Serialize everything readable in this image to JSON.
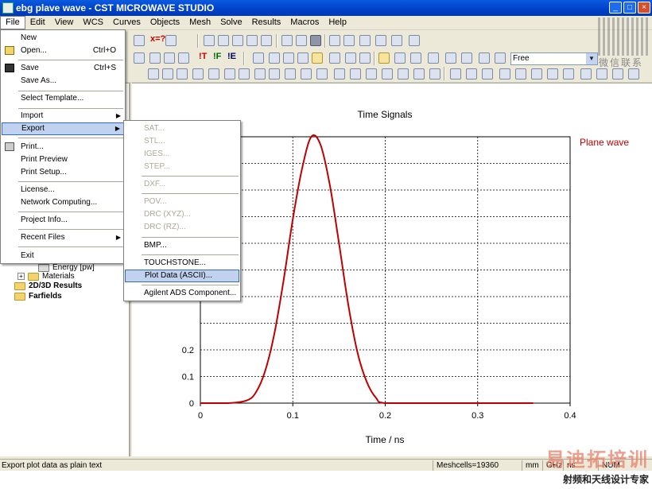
{
  "window": {
    "title": "ebg plave wave - CST MICROWAVE STUDIO",
    "buttons": [
      "_",
      "□",
      "×"
    ]
  },
  "menubar": {
    "items": [
      "File",
      "Edit",
      "View",
      "WCS",
      "Curves",
      "Objects",
      "Mesh",
      "Solve",
      "Results",
      "Macros",
      "Help"
    ],
    "active": "File"
  },
  "toolbar": {
    "free_combo": "Free",
    "text_buttons": [
      "x=?",
      "!T",
      "!F",
      "!E"
    ]
  },
  "file_menu": {
    "items": [
      {
        "label": "New",
        "shortcut": ""
      },
      {
        "label": "Open...",
        "shortcut": "Ctrl+O"
      },
      {
        "label": "Save",
        "shortcut": "Ctrl+S"
      },
      {
        "label": "Save As...",
        "shortcut": ""
      },
      {
        "label": "Select Template...",
        "shortcut": ""
      },
      {
        "label": "Import",
        "shortcut": "",
        "submenu": true
      },
      {
        "label": "Export",
        "shortcut": "",
        "submenu": true
      },
      {
        "label": "Print...",
        "shortcut": ""
      },
      {
        "label": "Print Preview",
        "shortcut": ""
      },
      {
        "label": "Print Setup...",
        "shortcut": ""
      },
      {
        "label": "License...",
        "shortcut": ""
      },
      {
        "label": "Network Computing...",
        "shortcut": ""
      },
      {
        "label": "Project Info...",
        "shortcut": ""
      },
      {
        "label": "Recent Files",
        "shortcut": "",
        "submenu": true
      },
      {
        "label": "Exit",
        "shortcut": ""
      }
    ],
    "highlighted": "Export"
  },
  "export_menu": {
    "items": [
      {
        "label": "SAT...",
        "enabled": false
      },
      {
        "label": "STL...",
        "enabled": false
      },
      {
        "label": "IGES...",
        "enabled": false
      },
      {
        "label": "STEP...",
        "enabled": false
      },
      {
        "label": "DXF...",
        "enabled": false
      },
      {
        "label": "POV...",
        "enabled": false
      },
      {
        "label": "DRC (XYZ)...",
        "enabled": false
      },
      {
        "label": "DRC (RZ)...",
        "enabled": false
      },
      {
        "label": "BMP...",
        "enabled": true
      },
      {
        "label": "TOUCHSTONE...",
        "enabled": true
      },
      {
        "label": "Plot Data (ASCII)...",
        "enabled": true
      },
      {
        "label": "Agilent ADS Component...",
        "enabled": true
      }
    ],
    "highlighted": "Plot Data (ASCII)..."
  },
  "tree": {
    "items": [
      {
        "label": "Energy [pw]",
        "bold": false,
        "expand": false
      },
      {
        "label": "Materials",
        "bold": false,
        "expand": true
      },
      {
        "label": "2D/3D Results",
        "bold": true,
        "expand": false
      },
      {
        "label": "Farfields",
        "bold": true,
        "expand": false
      }
    ]
  },
  "chart_data": {
    "type": "line",
    "title": "Time Signals",
    "xlabel": "Time / ns",
    "ylabel": "",
    "xlim": [
      0,
      0.4
    ],
    "ylim": [
      0,
      1
    ],
    "xticks": [
      "0",
      "0.1",
      "0.2",
      "0.3",
      "0.4"
    ],
    "yticks_visible": [
      "0",
      "0.1",
      "0.2"
    ],
    "grid": true,
    "series": [
      {
        "name": "Plane wave",
        "color": "#c00000",
        "x": [
          0,
          0.03,
          0.05,
          0.06,
          0.07,
          0.08,
          0.09,
          0.1,
          0.11,
          0.12,
          0.13,
          0.14,
          0.15,
          0.16,
          0.17,
          0.18,
          0.19,
          0.2,
          0.25,
          0.3,
          0.36
        ],
        "y": [
          0,
          0,
          0.01,
          0.04,
          0.12,
          0.26,
          0.46,
          0.69,
          0.88,
          1.0,
          0.97,
          0.82,
          0.6,
          0.37,
          0.19,
          0.08,
          0.02,
          0,
          0,
          0,
          0
        ]
      }
    ],
    "legend": "top-right"
  },
  "statusbar": {
    "message": "Export plot data as plain text",
    "meshcells": "Meshcells=19360",
    "units": [
      "mm",
      "GHz",
      "ns"
    ],
    "num": "NUM"
  },
  "watermark": {
    "line1": "易迪拓培训",
    "line2": "射频和天线设计专家",
    "qr_caption": "微信联系"
  }
}
